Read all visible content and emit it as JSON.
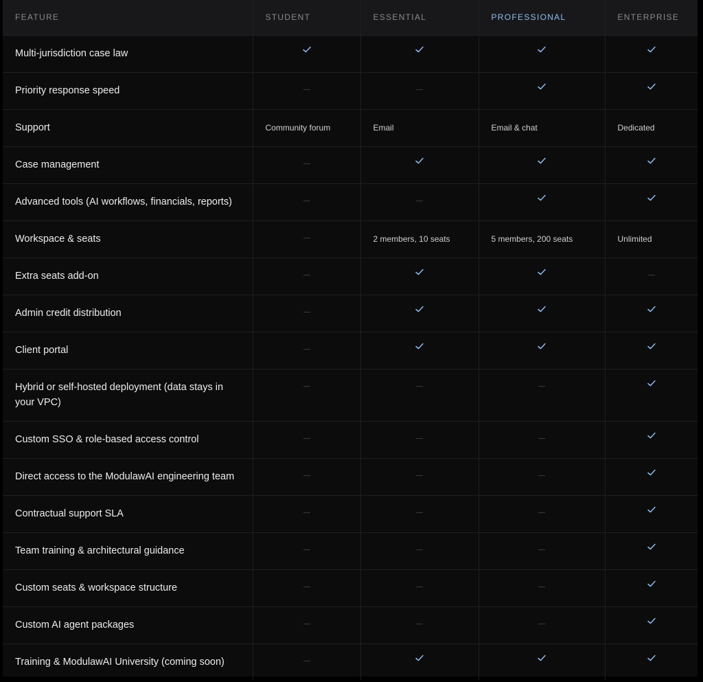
{
  "header": {
    "feature": "FEATURE",
    "student": "STUDENT",
    "essential": "ESSENTIAL",
    "professional": "PROFESSIONAL",
    "enterprise": "ENTERPRISE"
  },
  "colors": {
    "check": "#8fbdf0",
    "highlight_border": "#6fb0ec",
    "dash": "#3a3a3e"
  },
  "rows": [
    {
      "feature": "Multi-jurisdiction case law",
      "student": "check",
      "essential": "check",
      "professional": "check",
      "enterprise": "check"
    },
    {
      "feature": "Priority response speed",
      "student": "dash",
      "essential": "dash",
      "professional": "check",
      "enterprise": "check"
    },
    {
      "feature": "Support",
      "student": "Community forum",
      "essential": "Email",
      "professional": "Email & chat",
      "enterprise": "Dedicated"
    },
    {
      "feature": "Case management",
      "student": "dash",
      "essential": "check",
      "professional": "check",
      "enterprise": "check"
    },
    {
      "feature": "Advanced tools (AI workflows, financials, reports)",
      "student": "dash",
      "essential": "dash",
      "professional": "check",
      "enterprise": "check"
    },
    {
      "feature": "Workspace & seats",
      "student": "dash",
      "essential": "2 members, 10 seats",
      "professional": "5 members, 200 seats",
      "enterprise": "Unlimited"
    },
    {
      "feature": "Extra seats add-on",
      "student": "dash",
      "essential": "check",
      "professional": "check",
      "enterprise": "dash"
    },
    {
      "feature": "Admin credit distribution",
      "student": "dash",
      "essential": "check",
      "professional": "check",
      "enterprise": "check"
    },
    {
      "feature": "Client portal",
      "student": "dash",
      "essential": "check",
      "professional": "check",
      "enterprise": "check"
    },
    {
      "feature": "Hybrid or self-hosted deployment (data stays in your VPC)",
      "student": "dash",
      "essential": "dash",
      "professional": "dash",
      "enterprise": "check"
    },
    {
      "feature": "Custom SSO & role-based access control",
      "student": "dash",
      "essential": "dash",
      "professional": "dash",
      "enterprise": "check"
    },
    {
      "feature": "Direct access to the ModulawAI engineering team",
      "student": "dash",
      "essential": "dash",
      "professional": "dash",
      "enterprise": "check"
    },
    {
      "feature": "Contractual support SLA",
      "student": "dash",
      "essential": "dash",
      "professional": "dash",
      "enterprise": "check"
    },
    {
      "feature": "Team training & architectural guidance",
      "student": "dash",
      "essential": "dash",
      "professional": "dash",
      "enterprise": "check"
    },
    {
      "feature": "Custom seats & workspace structure",
      "student": "dash",
      "essential": "dash",
      "professional": "dash",
      "enterprise": "check"
    },
    {
      "feature": "Custom AI agent packages",
      "student": "dash",
      "essential": "dash",
      "professional": "dash",
      "enterprise": "check"
    },
    {
      "feature": "Training & ModulawAI University (coming soon)",
      "student": "dash",
      "essential": "check",
      "professional": "check",
      "enterprise": "check"
    }
  ]
}
